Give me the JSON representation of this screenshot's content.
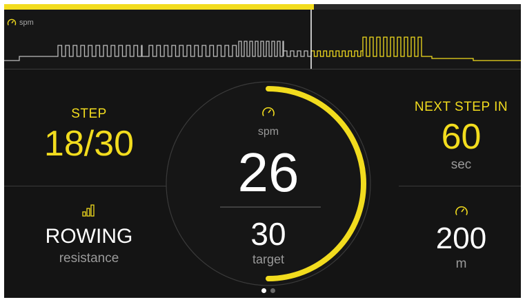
{
  "progress": {
    "fraction": 0.6
  },
  "graph": {
    "label": "spm",
    "icon": "speedometer-icon"
  },
  "step": {
    "label": "STEP",
    "value": "18/30"
  },
  "next_step": {
    "label": "NEXT STEP IN",
    "value": "60",
    "unit": "sec"
  },
  "mode": {
    "icon": "resistance-bars-icon",
    "value": "ROWING",
    "unit": "resistance"
  },
  "distance": {
    "icon": "speedometer-icon",
    "value": "200",
    "unit": "m"
  },
  "dial": {
    "icon": "speedometer-icon",
    "label": "spm",
    "current": "26",
    "target": "30",
    "target_label": "target",
    "progress_fraction": 0.5
  },
  "pager": {
    "pages": 2,
    "active": 0
  },
  "colors": {
    "accent": "#f2dc1e",
    "background": "#141414",
    "muted": "#9a9a9a"
  }
}
